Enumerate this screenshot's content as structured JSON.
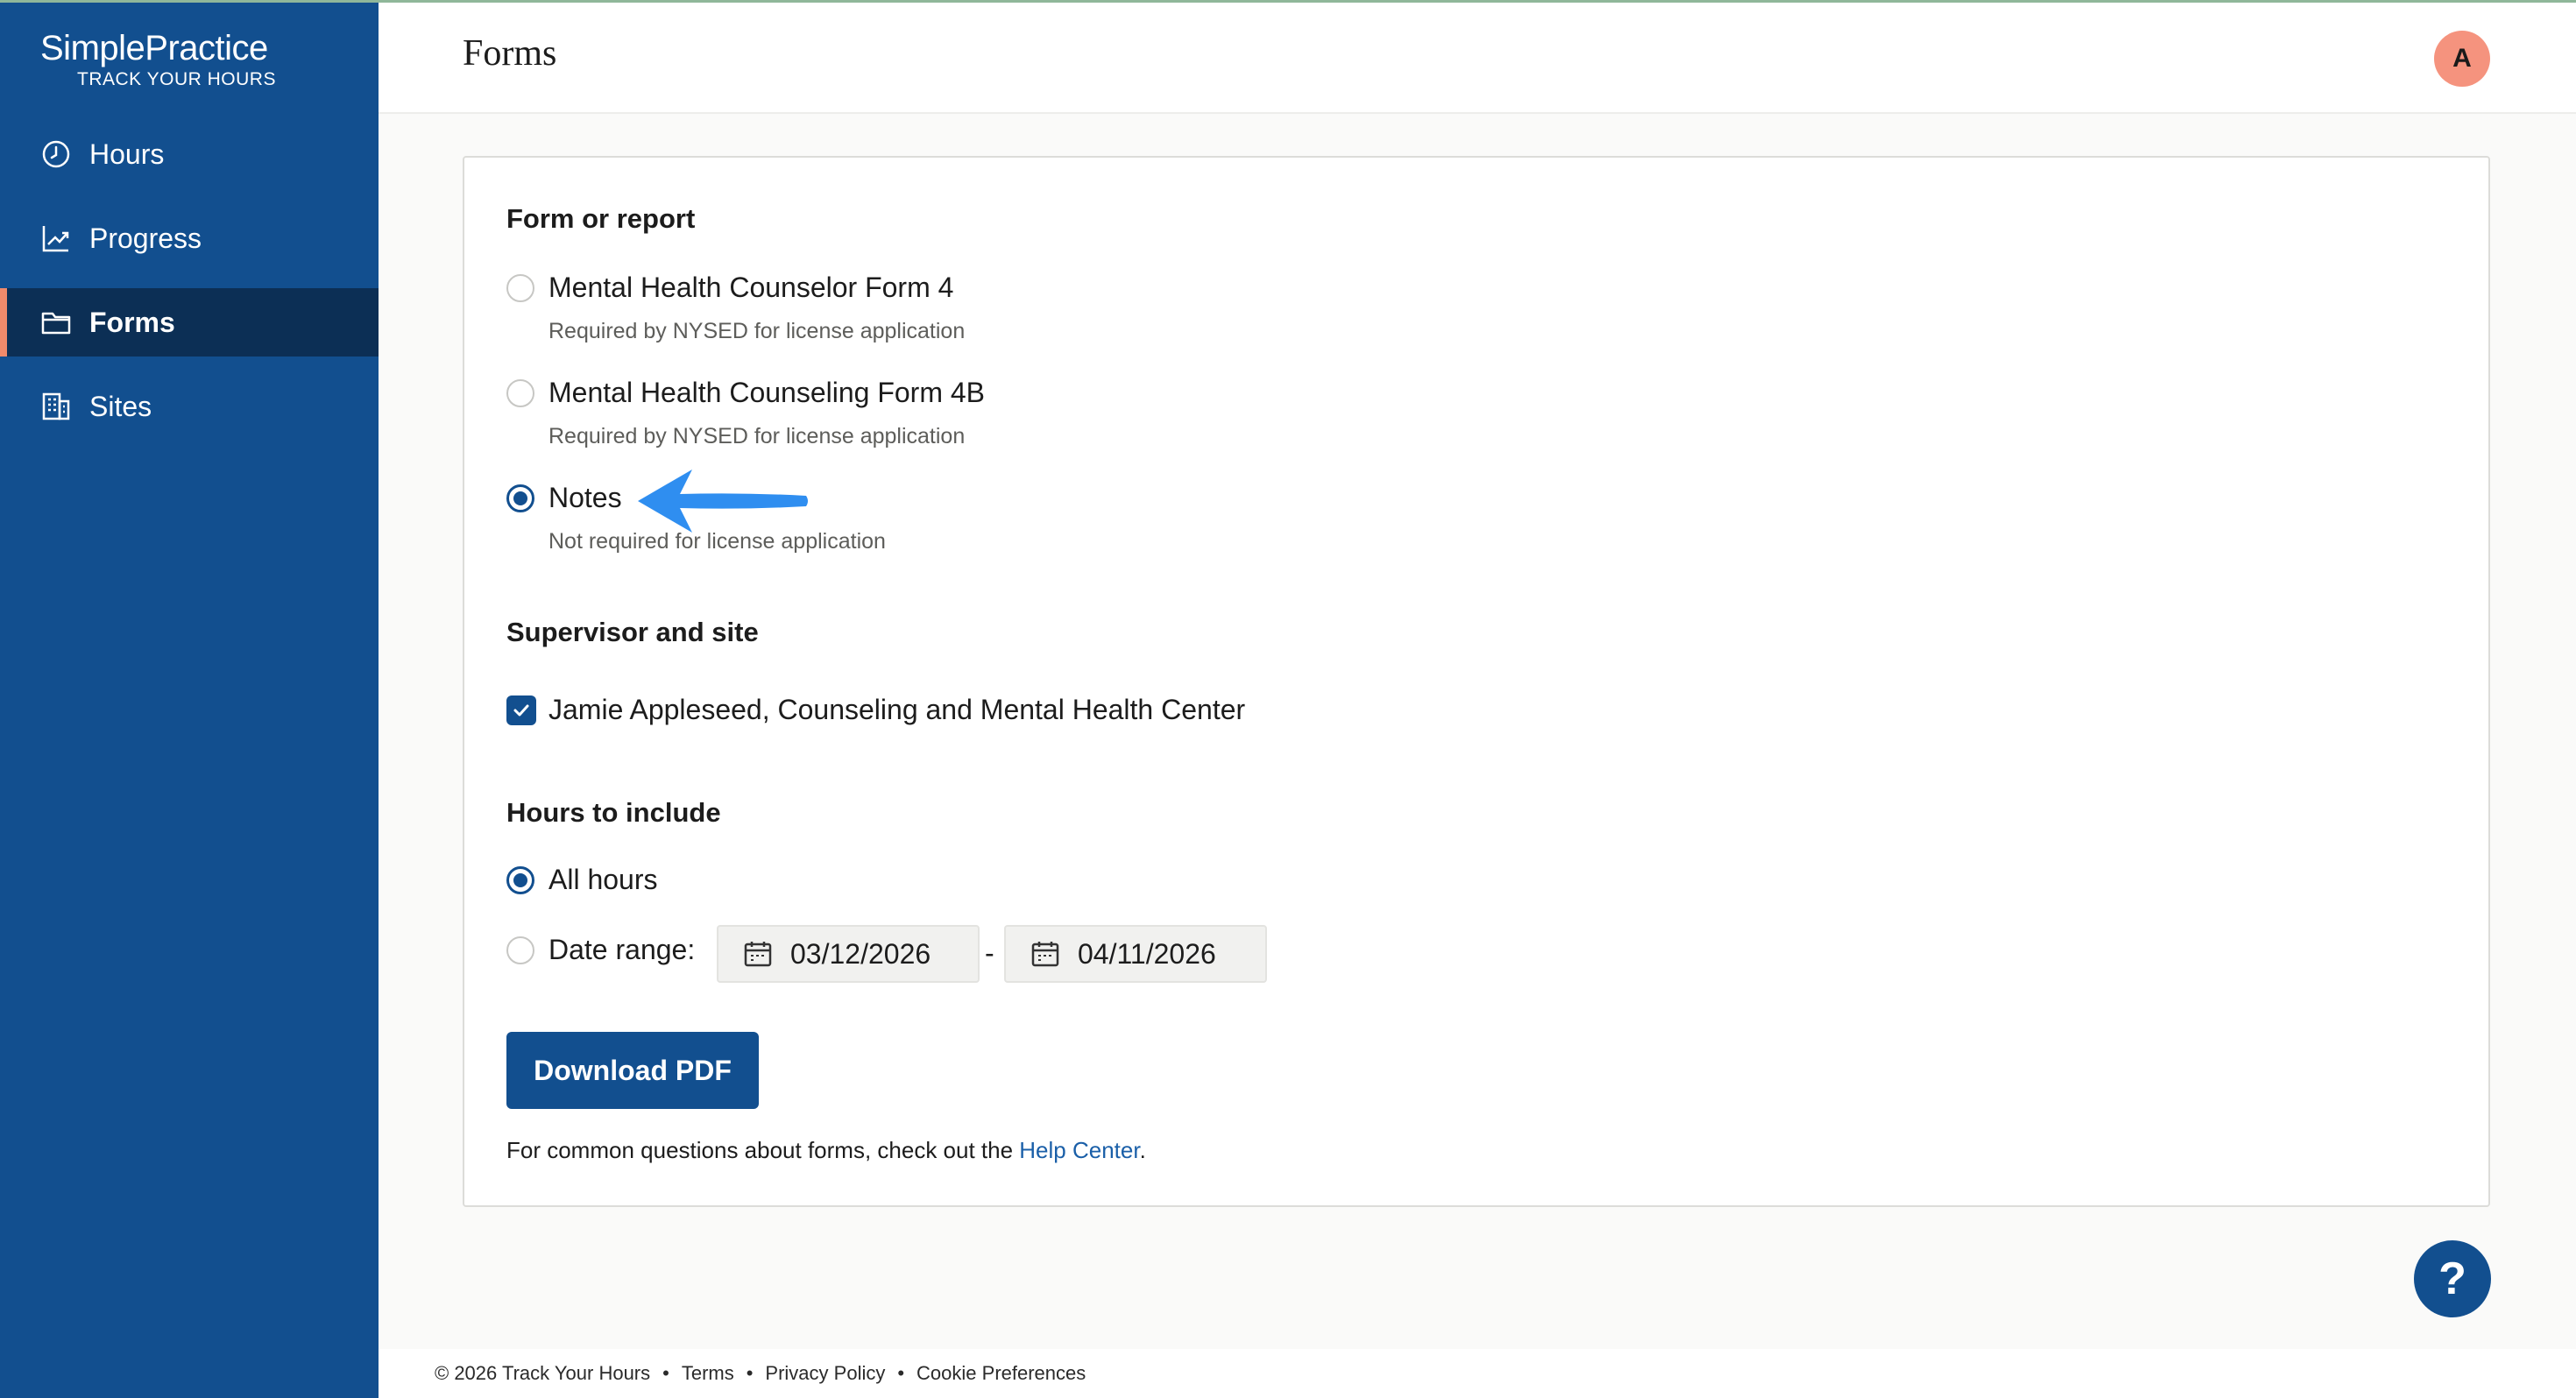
{
  "brand": {
    "name": "SimplePractice",
    "tagline": "TRACK YOUR HOURS"
  },
  "sidebar": {
    "items": [
      {
        "label": "Hours",
        "icon": "clock-icon",
        "active": false
      },
      {
        "label": "Progress",
        "icon": "chart-line-icon",
        "active": false
      },
      {
        "label": "Forms",
        "icon": "folder-icon",
        "active": true
      },
      {
        "label": "Sites",
        "icon": "building-icon",
        "active": false
      }
    ]
  },
  "header": {
    "title": "Forms",
    "avatar_initial": "A"
  },
  "form": {
    "section1_title": "Form or report",
    "options": [
      {
        "label": "Mental Health Counselor Form 4",
        "description": "Required by NYSED for license application",
        "selected": false
      },
      {
        "label": "Mental Health Counseling Form 4B",
        "description": "Required by NYSED for license application",
        "selected": false
      },
      {
        "label": "Notes",
        "description": "Not required for license application",
        "selected": true
      }
    ],
    "section2_title": "Supervisor and site",
    "supervisor": {
      "label": "Jamie Appleseed, Counseling and Mental Health Center",
      "checked": true
    },
    "section3_title": "Hours to include",
    "hours_options": {
      "all": "All hours",
      "range": "Date range:",
      "selected": "all"
    },
    "date_start": "03/12/2026",
    "date_sep": "-",
    "date_end": "04/11/2026",
    "download_label": "Download PDF",
    "help_text": "For common questions about forms, check out the ",
    "help_link": "Help Center",
    "help_suffix": "."
  },
  "help_button": "?",
  "footer": {
    "copyright": "© 2026 Track Your Hours",
    "links": [
      "Terms",
      "Privacy Policy",
      "Cookie Preferences"
    ],
    "separator": "•"
  },
  "colors": {
    "sidebar": "#124f8f",
    "sidebar_active": "#0c2f55",
    "accent": "#f08a6b",
    "primary": "#124f8f",
    "arrow": "#2f8ef0"
  }
}
